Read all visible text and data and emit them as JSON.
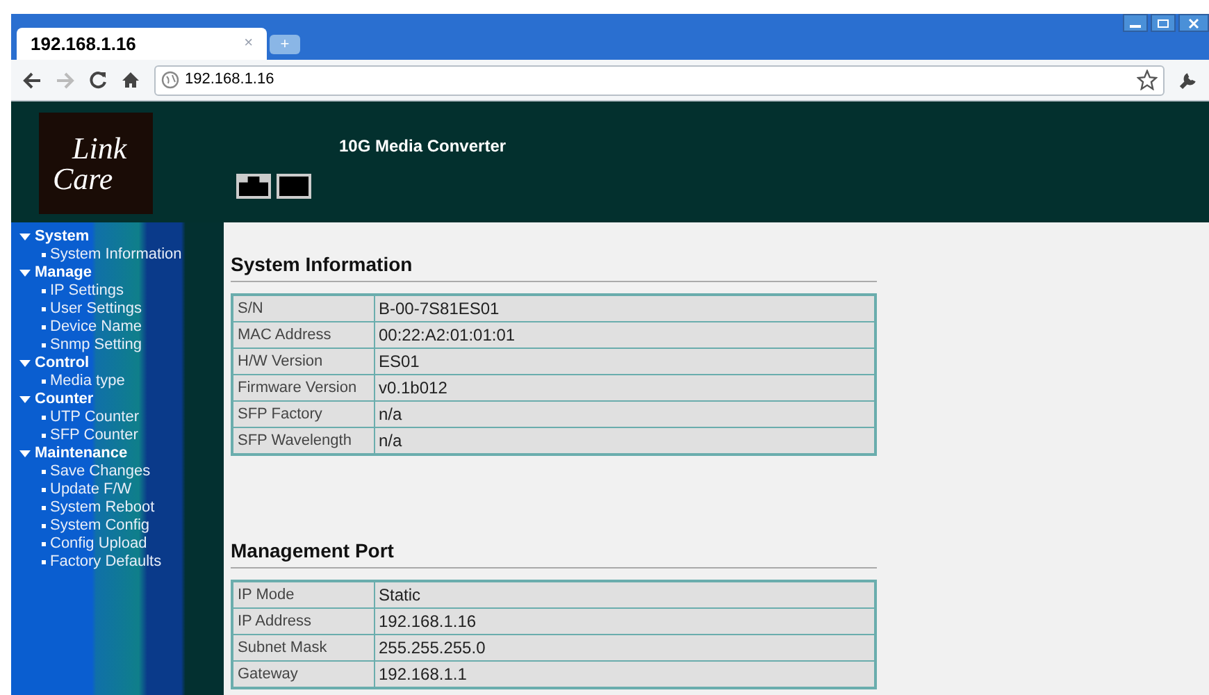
{
  "browser": {
    "tab_title": "192.168.1.16",
    "tab_close": "×",
    "new_tab": "+",
    "address": "192.168.1.16"
  },
  "header": {
    "logo_top": "Link",
    "logo_bottom": "Care",
    "title": "10G Media Converter"
  },
  "sidebar": [
    {
      "label": "System",
      "expanded": true,
      "children": [
        {
          "label": "System Information"
        }
      ]
    },
    {
      "label": "Manage",
      "expanded": true,
      "children": [
        {
          "label": "IP Settings"
        },
        {
          "label": "User Settings"
        },
        {
          "label": "Device Name"
        },
        {
          "label": "Snmp Setting"
        }
      ]
    },
    {
      "label": "Control",
      "expanded": true,
      "children": [
        {
          "label": "Media type"
        }
      ]
    },
    {
      "label": "Counter",
      "expanded": true,
      "children": [
        {
          "label": "UTP Counter"
        },
        {
          "label": "SFP Counter"
        }
      ]
    },
    {
      "label": "Maintenance",
      "expanded": true,
      "children": [
        {
          "label": "Save Changes"
        },
        {
          "label": "Update F/W"
        },
        {
          "label": "System Reboot"
        },
        {
          "label": "System Config"
        },
        {
          "label": "Config Upload"
        },
        {
          "label": "Factory Defaults"
        }
      ]
    }
  ],
  "sections": [
    {
      "title": "System Information",
      "rows": [
        [
          "S/N",
          "B-00-7S81ES01"
        ],
        [
          "MAC Address",
          "00:22:A2:01:01:01"
        ],
        [
          "H/W Version",
          "ES01"
        ],
        [
          "Firmware Version",
          "v0.1b012"
        ],
        [
          "SFP Factory",
          "n/a"
        ],
        [
          "SFP Wavelength",
          "n/a"
        ]
      ]
    },
    {
      "title": "Management Port",
      "rows": [
        [
          "IP Mode",
          "Static"
        ],
        [
          "IP Address",
          "192.168.1.16"
        ],
        [
          "Subnet Mask",
          "255.255.255.0"
        ],
        [
          "Gateway",
          "192.168.1.1"
        ]
      ]
    }
  ]
}
